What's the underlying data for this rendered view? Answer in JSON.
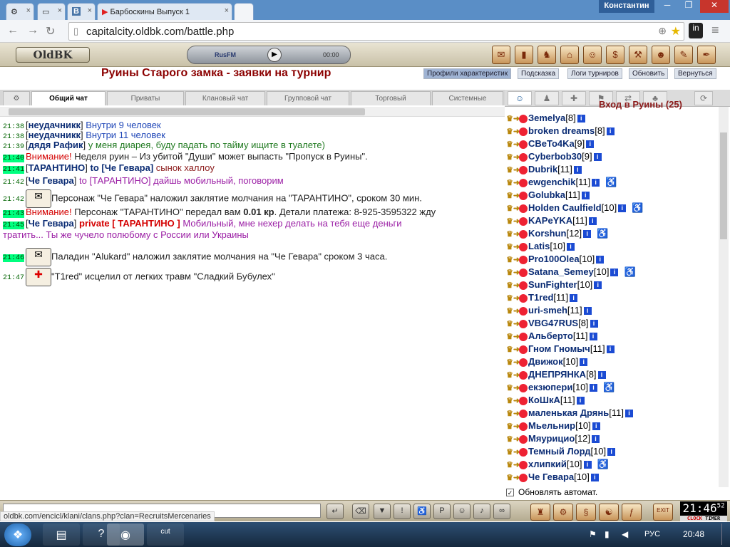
{
  "browser": {
    "tabs": [
      {
        "label": "",
        "icon": "gear-icon"
      },
      {
        "label": "",
        "icon": "page-icon"
      },
      {
        "label": "",
        "icon": "vk-icon"
      },
      {
        "label": "Барбоскины Выпуск 1",
        "icon": "youtube-icon"
      },
      {
        "label": "",
        "icon": "oldbk-icon"
      }
    ],
    "user": "Константин",
    "url": "capitalcity.oldbk.com/battle.php",
    "status_url": "oldbk.com/encicl/klani/clans.php?clan=RecruitsMercenaries"
  },
  "game": {
    "logo": "OldBK",
    "radio": "RusFM",
    "radio_time": "00:00",
    "title": "Руины Старого замка - заявки на турнир",
    "header_buttons": [
      "Профили характеристик",
      "Подсказка",
      "Логи турниров",
      "Обновить",
      "Вернуться"
    ],
    "chat_tabs": [
      "Общий чат",
      "Приваты",
      "Клановый чат",
      "Групповой чат",
      "Торговый",
      "Системные"
    ],
    "right_heading": "Вход в Руины (25)",
    "auto_update": "Обновлять автомат.",
    "clock": "21:46",
    "clock_sec": "52",
    "clock_labels": [
      "CLOCK",
      "TIMER"
    ],
    "exit_label": "EXIT"
  },
  "chat": [
    {
      "time": "21:38",
      "hl": false,
      "parts": [
        [
          "",
          "["
        ],
        [
          "nick",
          "неудачникк"
        ],
        [
          "",
          "] "
        ],
        [
          "blue",
          "Внутри 9 человек"
        ]
      ]
    },
    {
      "time": "21:38",
      "hl": false,
      "parts": [
        [
          "",
          "["
        ],
        [
          "nick",
          "неудачникк"
        ],
        [
          "",
          "] "
        ],
        [
          "blue",
          "Внутри 11 человек"
        ]
      ]
    },
    {
      "time": "21:39",
      "hl": false,
      "parts": [
        [
          "",
          "["
        ],
        [
          "nick",
          "дядя Рафик"
        ],
        [
          "",
          "] "
        ],
        [
          "green",
          "у меня диарея, буду падать по тайму ищите в туалете)"
        ]
      ]
    },
    {
      "time": "21:40",
      "hl": true,
      "parts": [
        [
          "red",
          "Внимание! "
        ],
        [
          "",
          "Неделя руин – Из убитой \"Души\" может выпасть \"Пропуск в Руины\"."
        ]
      ]
    },
    {
      "time": "21:41",
      "hl": true,
      "parts": [
        [
          "",
          "["
        ],
        [
          "nick",
          "ТАРАНТИНО"
        ],
        [
          "",
          "] "
        ],
        [
          "nick",
          "to ["
        ],
        [
          "nick",
          "Че Гевара"
        ],
        [
          "nick",
          "]"
        ],
        [
          "maroon",
          " сынок халлоу"
        ]
      ]
    },
    {
      "time": "21:42",
      "hl": false,
      "parts": [
        [
          "",
          "["
        ],
        [
          "nick",
          "Че Гевара"
        ],
        [
          "",
          "] "
        ],
        [
          "purple",
          "to [ТАРАНТИНО] дайшь мобильный, поговорим"
        ]
      ]
    },
    {
      "time": "21:42",
      "hl": false,
      "icon": "silence",
      "parts": [
        [
          "",
          "Персонаж \"Че Гевара\" наложил заклятие молчания на \"ТАРАНТИНО\", сроком 30 мин."
        ]
      ]
    },
    {
      "time": "21:43",
      "hl": true,
      "parts": [
        [
          "red",
          "Внимание! "
        ],
        [
          "",
          "Персонаж \"ТАРАНТИНО\" передал вам "
        ],
        [
          "bold",
          "0.01 кр"
        ],
        [
          "",
          ". Детали платежа: 8-925-3595322 жду"
        ]
      ]
    },
    {
      "time": "21:45",
      "hl": true,
      "parts": [
        [
          "",
          "["
        ],
        [
          "nick",
          "Че Гевара"
        ],
        [
          "",
          "] "
        ],
        [
          "redb",
          "private [ ТАРАНТИНО ]"
        ],
        [
          "purple",
          " Мобильный, мне нехер делать на тебя еще деньги"
        ]
      ]
    },
    {
      "time": "",
      "hl": false,
      "parts": [
        [
          "purple",
          "тратить... Ты же чучело полюбому с России или Украины"
        ]
      ]
    },
    {
      "time": "21:46",
      "hl": true,
      "icon": "silence",
      "parts": [
        [
          "",
          "Паладин \"Alukard\" наложил заклятие молчания на \"Че Гевара\" сроком 3 часа."
        ]
      ]
    },
    {
      "time": "21:47",
      "hl": false,
      "icon": "heal",
      "parts": [
        [
          "",
          "\"T1red\" исцелил от легких травм \"Сладкий Бубулех\""
        ]
      ]
    }
  ],
  "players": [
    {
      "name": "Зemelya",
      "level": "8",
      "injury": false
    },
    {
      "name": "broken dreams",
      "level": "8",
      "injury": false
    },
    {
      "name": "CBeTo4Ka",
      "level": "9",
      "injury": false
    },
    {
      "name": "Cyberbob30",
      "level": "9",
      "injury": false
    },
    {
      "name": "Dubrik",
      "level": "11",
      "injury": false
    },
    {
      "name": "ewgenchik",
      "level": "11",
      "injury": true
    },
    {
      "name": "Golubka",
      "level": "11",
      "injury": false
    },
    {
      "name": "Holden Caulfield",
      "level": "10",
      "injury": true
    },
    {
      "name": "KAPeYKA",
      "level": "11",
      "injury": false
    },
    {
      "name": "Korshun",
      "level": "12",
      "injury": true
    },
    {
      "name": "Latis",
      "level": "10",
      "injury": false
    },
    {
      "name": "Pro100Olea",
      "level": "10",
      "injury": false
    },
    {
      "name": "Satana_Semey",
      "level": "10",
      "injury": true
    },
    {
      "name": "SunFighter",
      "level": "10",
      "injury": false
    },
    {
      "name": "T1red",
      "level": "11",
      "injury": false
    },
    {
      "name": "uri-smeh",
      "level": "11",
      "injury": false
    },
    {
      "name": "VBG47RUS",
      "level": "8",
      "injury": false
    },
    {
      "name": "Альберто",
      "level": "11",
      "injury": false
    },
    {
      "name": "Гном Гномыч",
      "level": "11",
      "injury": false
    },
    {
      "name": "Движок",
      "level": "10",
      "injury": false
    },
    {
      "name": "ДНЕПРЯНКА",
      "level": "8",
      "injury": false
    },
    {
      "name": "екзюпери",
      "level": "10",
      "injury": true
    },
    {
      "name": "КоШкА",
      "level": "11",
      "injury": false
    },
    {
      "name": "маленькая Дрянь",
      "level": "11",
      "injury": false
    },
    {
      "name": "Мьельнир",
      "level": "10",
      "injury": false
    },
    {
      "name": "Мяурицио",
      "level": "12",
      "injury": false
    },
    {
      "name": "Темный Лорд",
      "level": "10",
      "injury": false
    },
    {
      "name": "хлипкий",
      "level": "10",
      "injury": true
    },
    {
      "name": "Че Гевара",
      "level": "10",
      "injury": false
    }
  ],
  "taskbar": {
    "lang": "РУС",
    "time": "20:48"
  },
  "colors": {
    "accent": "#8b0000",
    "highlight": "#00ff7f",
    "nick": "#0b2c74"
  }
}
